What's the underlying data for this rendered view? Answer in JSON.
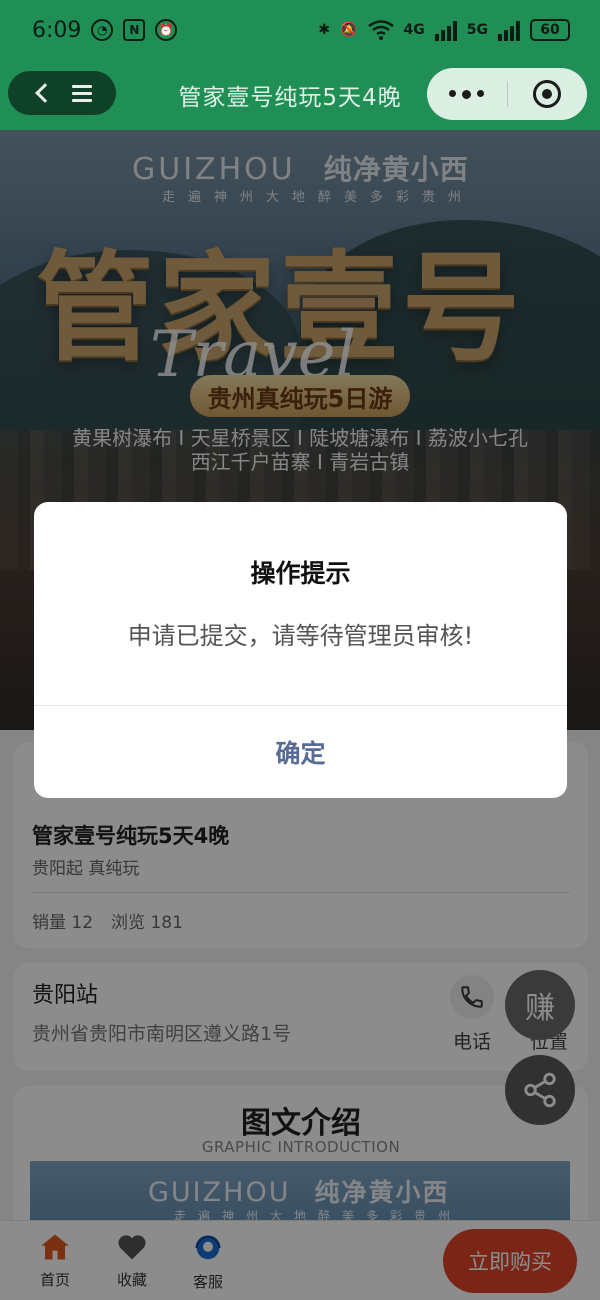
{
  "status_bar": {
    "time": "6:09",
    "battery": "60",
    "network_4g": "4G",
    "network_5g": "5G"
  },
  "nav": {
    "title": "管家壹号纯玩5天4晚"
  },
  "banner": {
    "brand_en": "GUIZHOU",
    "brand_cn": "纯净黄小西",
    "tagline": "走遍神州大地醉美多彩贵州",
    "headline": "管家壹号",
    "script_word": "Travel",
    "pill_text": "贵州真纯玩5日游",
    "spots_line1": "黄果树瀑布 I 天星桥景区 I 陡坡塘瀑布 I 荔波小七孔",
    "spots_line2": "西江千户苗寨 I 青岩古镇"
  },
  "product": {
    "title": "管家壹号纯玩5天4晚",
    "subtitle": "贵阳起 真纯玩",
    "sales_label": "销量 12",
    "views_label": "浏览 181"
  },
  "location": {
    "name": "贵阳站",
    "address": "贵州省贵阳市南明区遵义路1号",
    "phone_label": "电话",
    "position_label": "位置"
  },
  "intro": {
    "title": "图文介绍",
    "subtitle": "GRAPHIC INTRODUCTION",
    "image_brand_en": "GUIZHOU",
    "image_brand_cn": "纯净黄小西",
    "image_tagline": "走遍神州大地醉美多彩贵州"
  },
  "fab": {
    "earn_label": "赚"
  },
  "tabbar": {
    "home": "首页",
    "favorite": "收藏",
    "service": "客服",
    "buy": "立即购买"
  },
  "dialog": {
    "title": "操作提示",
    "message": "申请已提交，请等待管理员审核!",
    "confirm": "确定"
  },
  "colors": {
    "brand_green": "#1f8f56",
    "buy_red": "#e0442b",
    "confirm_blue": "#576b95",
    "home_active": "#e05a1f",
    "service_blue": "#1a6fd6"
  },
  "icons": {
    "back": "chevron-left-icon",
    "menu": "menu-icon",
    "more": "more-dots-icon",
    "close": "target-close-icon",
    "phone": "phone-icon",
    "position": "navigation-arrow-icon",
    "share": "share-icon",
    "home": "home-icon",
    "favorite": "heart-icon",
    "service": "headset-icon"
  }
}
